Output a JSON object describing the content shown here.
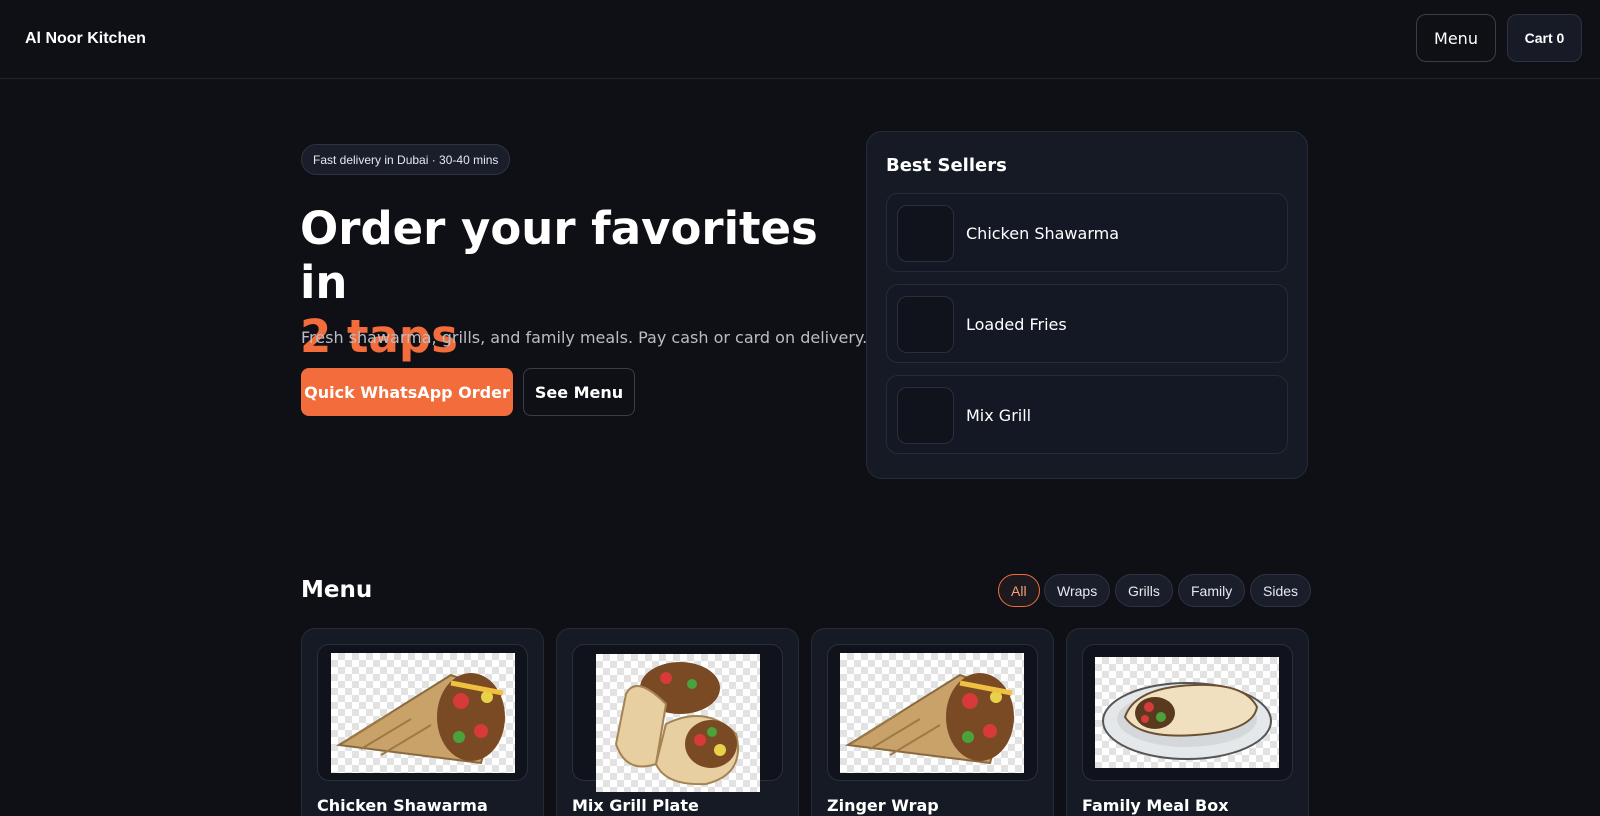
{
  "header": {
    "brand": "Al Noor Kitchen",
    "menu_label": "Menu",
    "cart_label": "Cart 0"
  },
  "hero": {
    "pill": "Fast delivery in Dubai · 30-40 mins",
    "title": "Order your favorites in",
    "title_accent": "2 taps",
    "subtitle": "Fresh shawarma, grills, and family meals. Pay cash or card on delivery.",
    "primary_cta": "Quick WhatsApp Order",
    "secondary_cta": "See Menu"
  },
  "best_sellers": {
    "title": "Best Sellers",
    "items": [
      {
        "name": "Chicken Shawarma"
      },
      {
        "name": "Loaded Fries"
      },
      {
        "name": "Mix Grill"
      }
    ]
  },
  "menu": {
    "heading": "Menu",
    "filters": [
      "All",
      "Wraps",
      "Grills",
      "Family",
      "Sides"
    ],
    "active_filter": "All",
    "items": [
      {
        "name": "Chicken Shawarma",
        "image": "shawarma-cone-image"
      },
      {
        "name": "Mix Grill Plate",
        "image": "double-wrap-image"
      },
      {
        "name": "Zinger Wrap",
        "image": "shawarma-cone-image"
      },
      {
        "name": "Family Meal Box",
        "image": "wrap-on-plate-image"
      }
    ]
  },
  "colors": {
    "background": "#0f1015",
    "accent": "#f26d3b",
    "card": "#161a25"
  }
}
